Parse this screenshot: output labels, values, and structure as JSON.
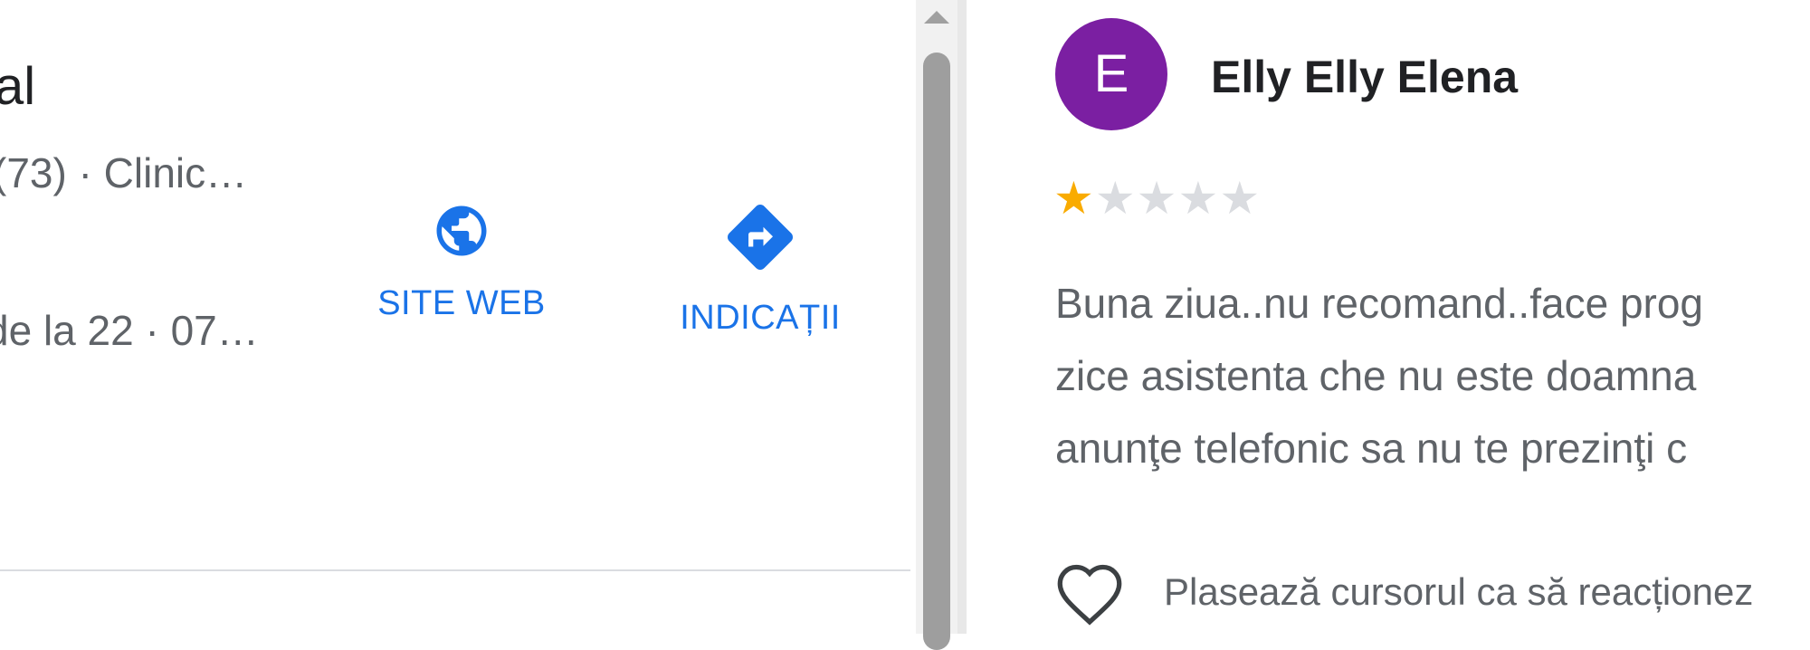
{
  "place": {
    "title": "al",
    "meta": "(73) · Clinic…",
    "hours": "de la 22 · 07…"
  },
  "actions": {
    "website_label": "SITE WEB",
    "directions_label": "INDICAȚII"
  },
  "review": {
    "avatar_letter": "E",
    "avatar_color": "#7b1fa2",
    "reviewer_name": "Elly Elly Elena",
    "rating": 1,
    "max_rating": 5,
    "text_lines": [
      "Buna ziua..nu recomand..face prog",
      "zice asistenta che nu este doamna",
      "anunţe telefonic sa nu te prezinţi c"
    ],
    "reaction_hint": "Plasează cursorul ca să reacționez"
  },
  "colors": {
    "accent": "#1a73e8",
    "star_on": "#f9ab00",
    "star_off": "#dadce0"
  }
}
